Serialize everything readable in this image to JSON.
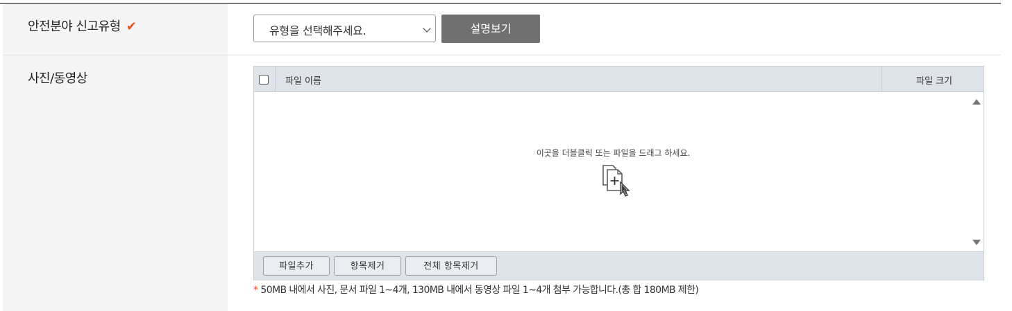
{
  "form": {
    "category": {
      "label": "안전분야 신고유형",
      "required_mark": "✔",
      "select_value": "유형을 선택해주세요.",
      "desc_button": "설명보기"
    },
    "media": {
      "label": "사진/동영상",
      "columns": {
        "name": "파일 이름",
        "size": "파일 크기"
      },
      "drop_hint": "이곳을 더블클릭 또는 파일을 드래그 하세요.",
      "buttons": {
        "add": "파일추가",
        "remove": "항목제거",
        "remove_all": "전체 항목제거"
      },
      "note_star": "*",
      "note": "50MB 내에서 사진, 문서 파일 1~4개, 130MB 내에서 동영상 파일 1~4개 첨부 가능합니다.(총 합 180MB 제한)"
    }
  },
  "colors": {
    "accent": "#e8501f",
    "button_dark": "#707070",
    "uploader_header": "#dfe3ea",
    "label_bg": "#f5f5f5"
  },
  "icons": [
    "check-icon",
    "chevron-down-icon",
    "file-add-cursor-icon",
    "scroll-up-icon",
    "scroll-down-icon"
  ]
}
